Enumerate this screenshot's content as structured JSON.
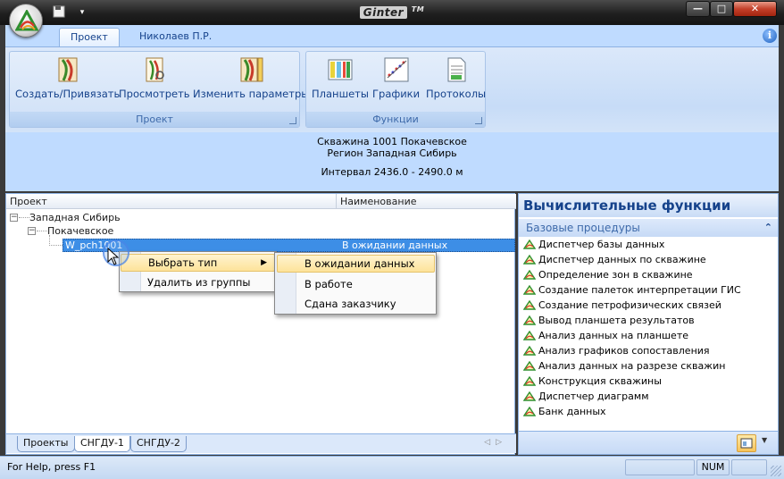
{
  "window": {
    "title_logo": "Ginter",
    "title_mark": "TM",
    "min_glyph": "—",
    "max_glyph": "□",
    "close_glyph": "✕"
  },
  "ribbon": {
    "tabs": [
      {
        "label": "Проект",
        "active": true
      },
      {
        "label": "Николаев П.Р.",
        "active": false
      }
    ],
    "groups": [
      {
        "label": "Проект",
        "buttons": [
          {
            "label": "Создать/Привязать",
            "icon": "create-bind-icon"
          },
          {
            "label": "Просмотреть",
            "icon": "view-icon"
          },
          {
            "label": "Изменить параметры",
            "icon": "edit-params-icon"
          }
        ]
      },
      {
        "label": "Функции",
        "buttons": [
          {
            "label": "Планшеты",
            "icon": "tablets-icon"
          },
          {
            "label": "Графики",
            "icon": "charts-icon"
          },
          {
            "label": "Протоколы",
            "icon": "protocols-icon"
          }
        ]
      }
    ]
  },
  "info": {
    "line1": "Скважина 1001  Покачевское",
    "line2": "Регион Западная Сибирь",
    "line3": "Интервал 2436.0 - 2490.0 м"
  },
  "tree": {
    "col_project": "Проект",
    "col_name": "Наименование",
    "nodes": [
      {
        "label": "Западная Сибирь"
      },
      {
        "label": "Покачевское"
      },
      {
        "label": "W_pch1001",
        "value": "В ожидании данных"
      }
    ]
  },
  "context_menu": {
    "items": [
      {
        "label": "Выбрать тип",
        "arrow": "▶"
      },
      {
        "label": "Удалить из группы"
      }
    ]
  },
  "submenu": {
    "items": [
      {
        "label": "В ожидании данных"
      },
      {
        "label": "В работе"
      },
      {
        "label": "Сдана заказчику"
      }
    ]
  },
  "bottom_tabs": [
    {
      "label": "Проекты"
    },
    {
      "label": "СНГДУ-1"
    },
    {
      "label": "СНГДУ-2"
    }
  ],
  "functions_panel": {
    "title": "Вычислительные функции",
    "section": "Базовые процедуры",
    "collapse_glyph": "⌃",
    "items": [
      "Диспетчер базы данных",
      "Диспетчер данных по скважине",
      "Определение зон в скважине",
      "Создание палеток интерпретации ГИС",
      "Создание петрофизических связей",
      "Вывод планшета результатов",
      "Анализ данных на планшете",
      "Анализ графиков сопоставления",
      "Анализ данных на разрезе скважин",
      "Конструкция скважины",
      "Диспетчер диаграмм",
      "Банк данных"
    ]
  },
  "statusbar": {
    "help_text": "For Help, press F1",
    "num": "NUM"
  }
}
